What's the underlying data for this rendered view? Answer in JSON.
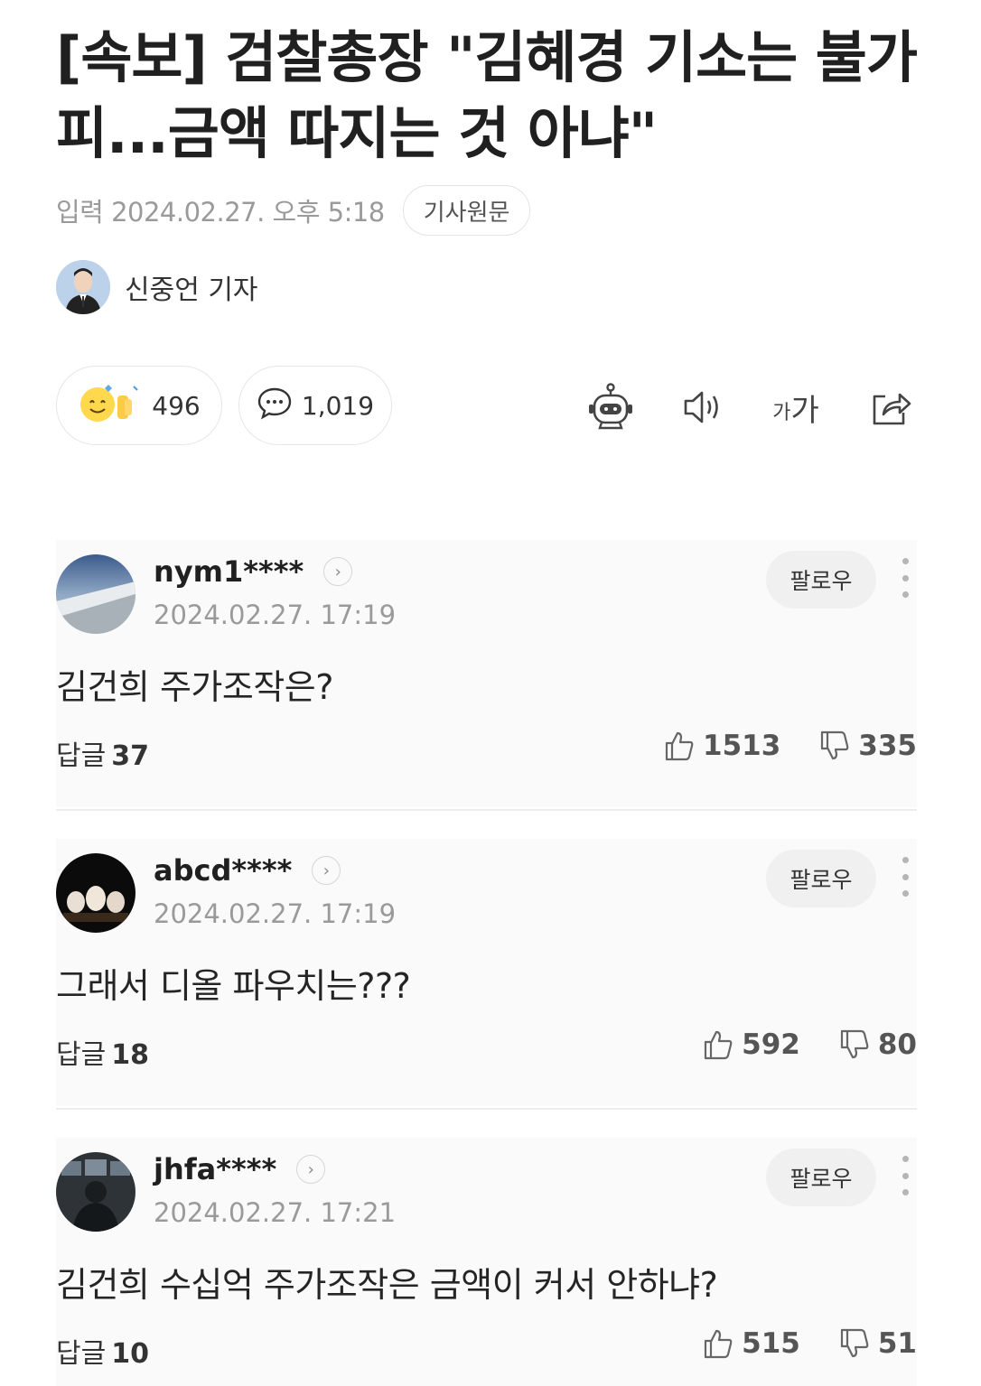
{
  "article": {
    "title_line1": "[속보] 검찰총장 \"김혜경 기소는 불가",
    "title_line2": "피...금액 따지는 것 아냐\"",
    "published": "입력 2024.02.27. 오후 5:18",
    "original_button": "기사원문",
    "reporter": "신중언 기자"
  },
  "actions": {
    "reactions_count": "496",
    "comments_count": "1,019",
    "font_size_label_small": "가",
    "font_size_label_large": "가"
  },
  "comments": [
    {
      "user": "nym1****",
      "date": "2024.02.27. 17:19",
      "follow_label": "팔로우",
      "text": "김건희 주가조작은?",
      "reply_label": "답글",
      "reply_count": "37",
      "likes": "1513",
      "dislikes": "335"
    },
    {
      "user": "abcd****",
      "date": "2024.02.27. 17:19",
      "follow_label": "팔로우",
      "text": "그래서 디올 파우치는???",
      "reply_label": "답글",
      "reply_count": "18",
      "likes": "592",
      "dislikes": "80"
    },
    {
      "user": "jhfa****",
      "date": "2024.02.27. 17:21",
      "follow_label": "팔로우",
      "text": "김건희 수십억 주가조작은 금액이 커서 안하냐?",
      "reply_label": "답글",
      "reply_count": "10",
      "likes": "515",
      "dislikes": "51"
    }
  ],
  "colors": {
    "text_primary": "#202020",
    "text_muted": "#9a9a9a",
    "border": "#e6e6e6",
    "follow_bg": "#f0f0f0"
  },
  "icons": [
    "reaction-emoji-icon",
    "comment-bubble-icon",
    "robot-summary-icon",
    "speaker-icon",
    "font-size-icon",
    "share-icon",
    "chevron-right-icon",
    "more-vertical-icon",
    "thumbs-up-icon",
    "thumbs-down-icon"
  ]
}
